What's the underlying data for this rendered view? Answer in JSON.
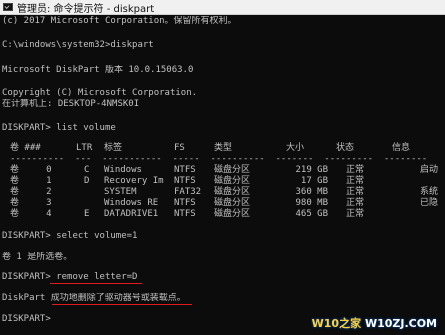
{
  "window": {
    "title": "管理员: 命令提示符 - diskpart",
    "icon": "cmd-icon"
  },
  "console": {
    "lines": [
      "(c) 2017 Microsoft Corporation。保留所有权利。",
      "",
      "C:\\windows\\system32>diskpart",
      "",
      "Microsoft DiskPart 版本 10.0.15063.0",
      "",
      "Copyright (C) Microsoft Corporation.",
      "在计算机上: DESKTOP-4NMSK0I",
      "",
      "DISKPART> list volume"
    ],
    "table": {
      "headers": [
        "卷 ###",
        "LTR",
        "标签",
        "FS",
        "类型",
        "大小",
        "状态",
        "信息"
      ],
      "rows": [
        {
          "vol": "卷     0",
          "ltr": "C",
          "label": "Windows",
          "fs": "NTFS",
          "type": "磁盘分区",
          "size": "219 GB",
          "status": "正常",
          "info": "启动"
        },
        {
          "vol": "卷     1",
          "ltr": "D",
          "label": "Recovery Im",
          "fs": "NTFS",
          "type": "磁盘分区",
          "size": "17 GB",
          "status": "正常",
          "info": ""
        },
        {
          "vol": "卷     2",
          "ltr": "",
          "label": "SYSTEM",
          "fs": "FAT32",
          "type": "磁盘分区",
          "size": "360 MB",
          "status": "正常",
          "info": "系统"
        },
        {
          "vol": "卷     3",
          "ltr": "",
          "label": "Windows RE",
          "fs": "NTFS",
          "type": "磁盘分区",
          "size": "980 MB",
          "status": "正常",
          "info": "已隐"
        },
        {
          "vol": "卷     4",
          "ltr": "E",
          "label": "DATADRIVE1",
          "fs": "NTFS",
          "type": "磁盘分区",
          "size": "465 GB",
          "status": "正常",
          "info": ""
        }
      ]
    },
    "after": {
      "select_cmd": "DISKPART> select volume=1",
      "select_result": "卷 1 是所选卷。",
      "remove_prompt": "DISKPART>",
      "remove_cmd": "remove letter=D",
      "remove_result_prefix": "DiskPart",
      "remove_result": "成功地删除了驱动器号或装载点。",
      "final_prompt": "DISKPART>"
    }
  },
  "colors": {
    "background": "#0c0c0c",
    "text": "#c0c0c0",
    "highlight_underline": "#e11b1b"
  },
  "watermark": {
    "left": "W10之家",
    "right": "W10ZJ.COM"
  }
}
